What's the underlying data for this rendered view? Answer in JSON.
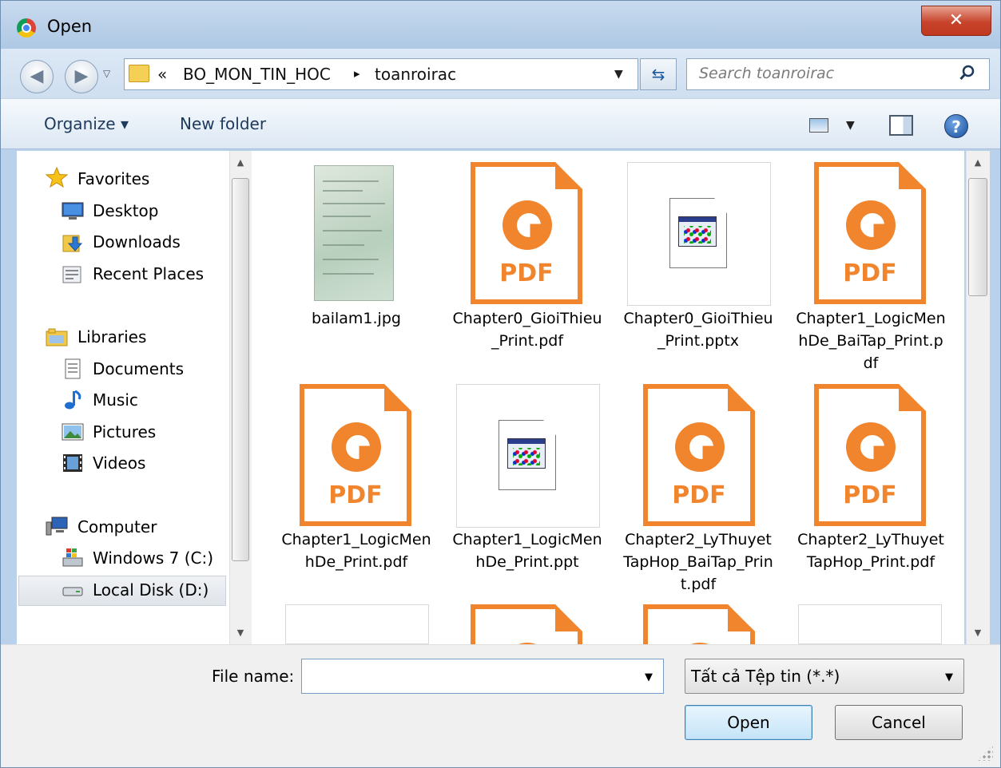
{
  "window": {
    "title": "Open",
    "close_glyph": "✕"
  },
  "address": {
    "prefix": "«",
    "crumbs": [
      "BO_MON_TIN_HOC",
      "toanroirac"
    ],
    "separator": "▸"
  },
  "search": {
    "placeholder": "Search toanroirac"
  },
  "toolbar": {
    "organize": "Organize ▾",
    "new_folder": "New folder",
    "help": "?"
  },
  "nav": {
    "items": [
      {
        "label": "Favorites",
        "icon": "star-icon"
      },
      {
        "label": "Desktop",
        "icon": "desktop-icon"
      },
      {
        "label": "Downloads",
        "icon": "downloads-icon"
      },
      {
        "label": "Recent Places",
        "icon": "recent-places-icon"
      },
      {
        "label": "Libraries",
        "icon": "libraries-icon"
      },
      {
        "label": "Documents",
        "icon": "documents-icon"
      },
      {
        "label": "Music",
        "icon": "music-icon"
      },
      {
        "label": "Pictures",
        "icon": "pictures-icon"
      },
      {
        "label": "Videos",
        "icon": "videos-icon"
      },
      {
        "label": "Computer",
        "icon": "computer-icon"
      },
      {
        "label": "Windows 7  (C:)",
        "icon": "drive-c-icon"
      },
      {
        "label": "Local Disk (D:)",
        "icon": "drive-d-icon"
      }
    ],
    "selected": "Local Disk (D:)"
  },
  "files": [
    {
      "name": "bailam1.jpg",
      "type": "jpg"
    },
    {
      "name": "Chapter0_GioiThieu_Print.pdf",
      "type": "pdf"
    },
    {
      "name": "Chapter0_GioiThieu_Print.pptx",
      "type": "pptx"
    },
    {
      "name": "Chapter1_LogicMenhDe_BaiTap_Print.pdf",
      "type": "pdf"
    },
    {
      "name": "Chapter1_LogicMenhDe_Print.pdf",
      "type": "pdf"
    },
    {
      "name": "Chapter1_LogicMenhDe_Print.ppt",
      "type": "ppt"
    },
    {
      "name": "Chapter2_LyThuyetTapHop_BaiTap_Print.pdf",
      "type": "pdf"
    },
    {
      "name": "Chapter2_LyThuyetTapHop_Print.pdf",
      "type": "pdf"
    }
  ],
  "pdf_badge": "PDF",
  "bottom": {
    "file_name_label": "File name:",
    "file_name_value": "",
    "filter_value": "Tất cả Tệp tin (*.*)",
    "open_label": "Open",
    "cancel_label": "Cancel"
  },
  "colors": {
    "pdf_accent": "#f0852d",
    "close_button": "#c7432b",
    "title_bar": "#b9d1ea"
  }
}
